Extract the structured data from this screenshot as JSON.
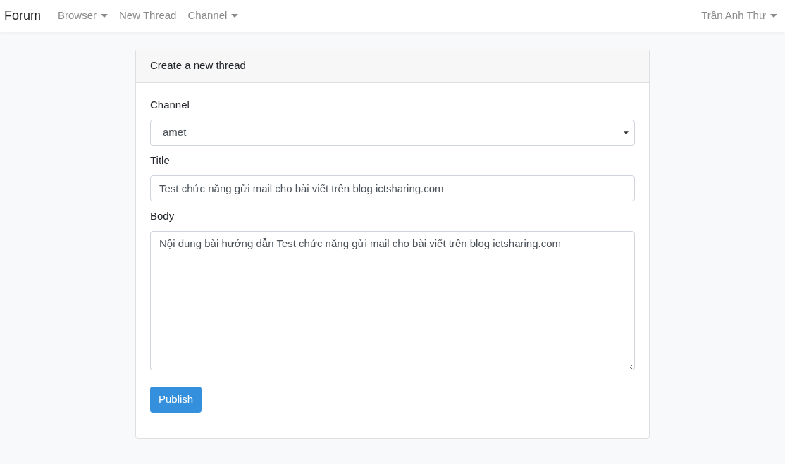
{
  "navbar": {
    "brand": "Forum",
    "items": [
      {
        "label": "Browser",
        "dropdown": true
      },
      {
        "label": "New Thread",
        "dropdown": false
      },
      {
        "label": "Channel",
        "dropdown": true
      }
    ],
    "user": {
      "label": "Trần Anh Thư",
      "dropdown": true
    }
  },
  "card": {
    "title": "Create a new thread",
    "fields": [
      {
        "kind": "select",
        "label": "Channel",
        "value": "amet"
      },
      {
        "kind": "input",
        "label": "Title",
        "value": "Test chức năng gửi mail cho bài viết trên blog ictsharing.com"
      },
      {
        "kind": "textarea",
        "label": "Body",
        "value": "Nội dung bài hướng dẫn Test chức năng gửi mail cho bài viết trên blog ictsharing.com"
      }
    ],
    "button": "Publish"
  }
}
